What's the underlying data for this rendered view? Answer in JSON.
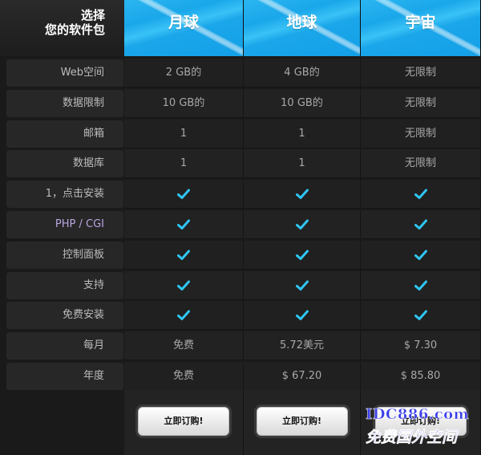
{
  "corner": {
    "line1": "选择",
    "line2": "您的软件包"
  },
  "plans": [
    {
      "name": "月球",
      "button": "立即订购!"
    },
    {
      "name": "地球",
      "button": "立即订购!"
    },
    {
      "name": "宇宙",
      "button": "立即订购!"
    }
  ],
  "rows": [
    {
      "label": "Web空间",
      "values": [
        "2 GB的",
        "4 GB的",
        "无限制"
      ]
    },
    {
      "label": "数据限制",
      "values": [
        "10 GB的",
        "10 GB的",
        "无限制"
      ]
    },
    {
      "label": "邮箱",
      "values": [
        "1",
        "1",
        "无限制"
      ]
    },
    {
      "label": "数据库",
      "values": [
        "1",
        "1",
        "无限制"
      ]
    },
    {
      "label": "1，点击安装",
      "values": [
        "check",
        "check",
        "check"
      ]
    },
    {
      "label": "PHP / CGI",
      "values": [
        "check",
        "check",
        "check"
      ]
    },
    {
      "label": "控制面板",
      "values": [
        "check",
        "check",
        "check"
      ]
    },
    {
      "label": "支持",
      "values": [
        "check",
        "check",
        "check"
      ]
    },
    {
      "label": "免费安装",
      "values": [
        "check",
        "check",
        "check"
      ]
    },
    {
      "label": "每月",
      "values": [
        "免费",
        "5.72美元",
        "$ 7.30"
      ]
    },
    {
      "label": "年度",
      "values": [
        "免费",
        "$ 67.20",
        "$ 85.80"
      ]
    }
  ],
  "watermark": {
    "line1": "IDC886.com",
    "line2": "免费国外空间"
  },
  "colors": {
    "accent": "#1ba6ea",
    "check": "#2fc6f4"
  }
}
